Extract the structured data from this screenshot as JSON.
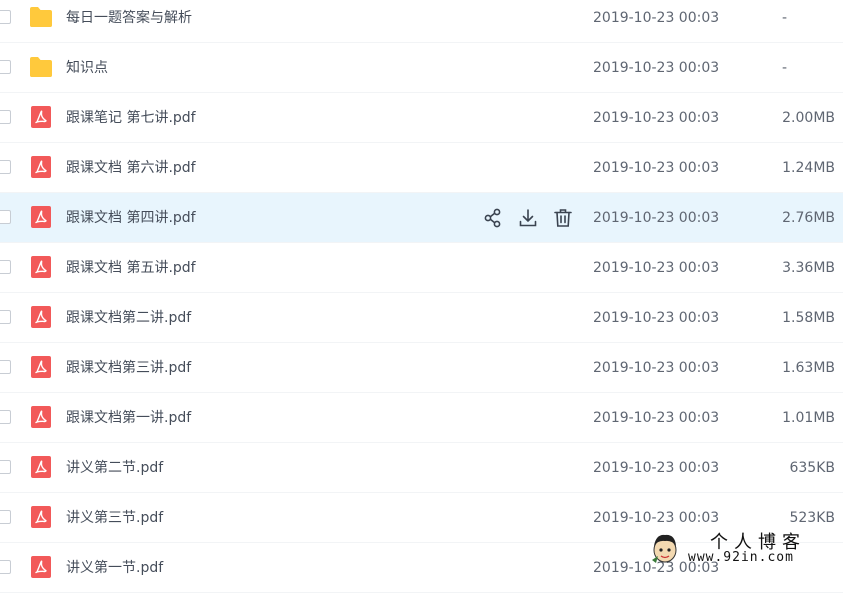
{
  "files": [
    {
      "name": "每日一题答案与解析",
      "type": "folder",
      "date": "2019-10-23 00:03",
      "size": "-"
    },
    {
      "name": "知识点",
      "type": "folder",
      "date": "2019-10-23 00:03",
      "size": "-"
    },
    {
      "name": "跟课笔记 第七讲.pdf",
      "type": "pdf",
      "date": "2019-10-23 00:03",
      "size": "2.00MB"
    },
    {
      "name": "跟课文档 第六讲.pdf",
      "type": "pdf",
      "date": "2019-10-23 00:03",
      "size": "1.24MB"
    },
    {
      "name": "跟课文档 第四讲.pdf",
      "type": "pdf",
      "date": "2019-10-23 00:03",
      "size": "2.76MB"
    },
    {
      "name": "跟课文档 第五讲.pdf",
      "type": "pdf",
      "date": "2019-10-23 00:03",
      "size": "3.36MB"
    },
    {
      "name": "跟课文档第二讲.pdf",
      "type": "pdf",
      "date": "2019-10-23 00:03",
      "size": "1.58MB"
    },
    {
      "name": "跟课文档第三讲.pdf",
      "type": "pdf",
      "date": "2019-10-23 00:03",
      "size": "1.63MB"
    },
    {
      "name": "跟课文档第一讲.pdf",
      "type": "pdf",
      "date": "2019-10-23 00:03",
      "size": "1.01MB"
    },
    {
      "name": "讲义第二节.pdf",
      "type": "pdf",
      "date": "2019-10-23 00:03",
      "size": "635KB"
    },
    {
      "name": "讲义第三节.pdf",
      "type": "pdf",
      "date": "2019-10-23 00:03",
      "size": "523KB"
    },
    {
      "name": "讲义第一节.pdf",
      "type": "pdf",
      "date": "2019-10-23 00:03",
      "size": ""
    }
  ],
  "hovered_row": 4,
  "row_actions": [
    "share-icon",
    "download-icon",
    "delete-icon"
  ],
  "colors": {
    "folder": "#ffc93c",
    "pdf": "#f25959",
    "hover_bg": "#e8f5fd",
    "text": "#454d5a"
  },
  "watermark": {
    "title": "个人博客",
    "url": "www.92in.com"
  }
}
